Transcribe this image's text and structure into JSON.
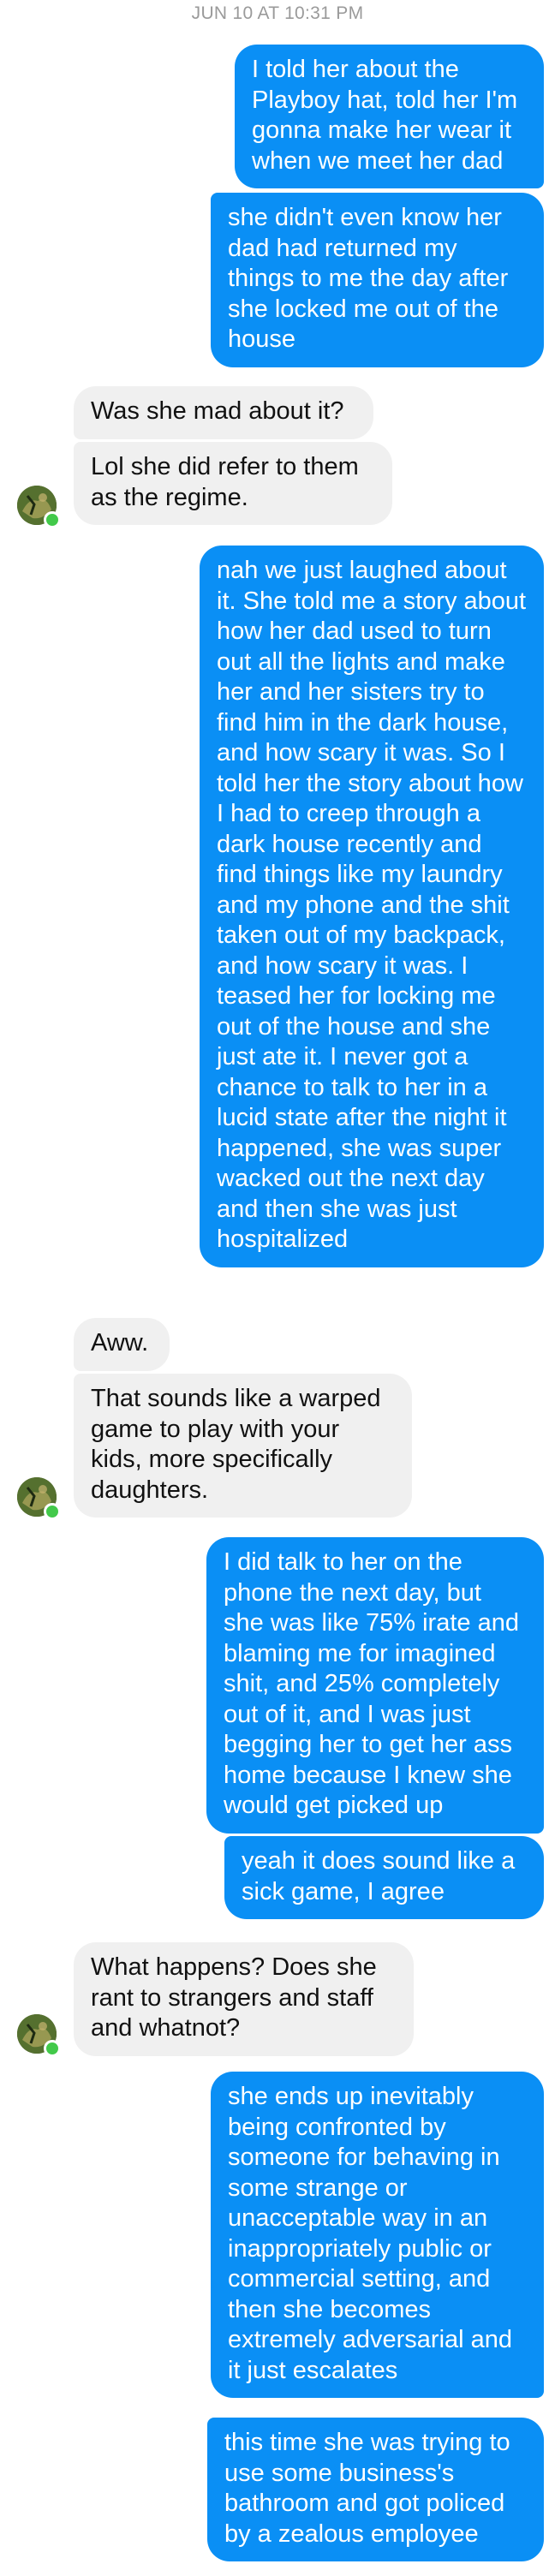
{
  "conversation": {
    "timestamp": "JUN 10 AT 10:31 PM",
    "colors": {
      "outgoing": "#0a8ff5",
      "incoming": "#f0f0f0",
      "online": "#42c94a"
    },
    "contact_avatar_icon": "contact-avatar",
    "messages": [
      {
        "direction": "outgoing",
        "text": "I told her about the Playboy hat, told her I'm gonna make her wear it when we meet her dad"
      },
      {
        "direction": "outgoing",
        "text": "she didn't even know her dad had returned my things to me the day after she locked me out of the house"
      },
      {
        "direction": "incoming",
        "text": "Was she mad about it?"
      },
      {
        "direction": "incoming",
        "text": "Lol she did refer to them as the regime."
      },
      {
        "direction": "outgoing",
        "text": "nah we just laughed about it. She told me a story about how her dad used to turn out all the lights and make her and her sisters try to find him in the dark house, and how scary it was. So I told her the story about how I had to creep through a dark house recently and find things like my laundry and my phone and the shit taken out of my backpack, and how scary it was. I teased her for locking me out of the house and she just ate it. I never got a chance to talk to her in a lucid state after the night it happened, she was super wacked out the next day and then she was just hospitalized"
      },
      {
        "direction": "incoming",
        "text": "Aww."
      },
      {
        "direction": "incoming",
        "text": "That sounds like a warped game to play with your kids, more specifically daughters."
      },
      {
        "direction": "outgoing",
        "text": "I did talk to her on the phone the next day, but she was like 75% irate and blaming me for imagined shit, and 25% completely out of it, and I was just begging her to get her ass home because I knew she would get picked up"
      },
      {
        "direction": "outgoing",
        "text": "yeah it does sound like a sick game, I agree"
      },
      {
        "direction": "incoming",
        "text": "What happens? Does she rant to strangers and staff and whatnot?"
      },
      {
        "direction": "outgoing",
        "text": "she ends up inevitably being confronted by someone for behaving in some strange or unacceptable way in an inappropriately public or commercial setting, and then she becomes extremely adversarial and it just escalates"
      },
      {
        "direction": "outgoing",
        "text": "this time she was trying to use some business's bathroom and got policed by a zealous employee"
      }
    ]
  }
}
